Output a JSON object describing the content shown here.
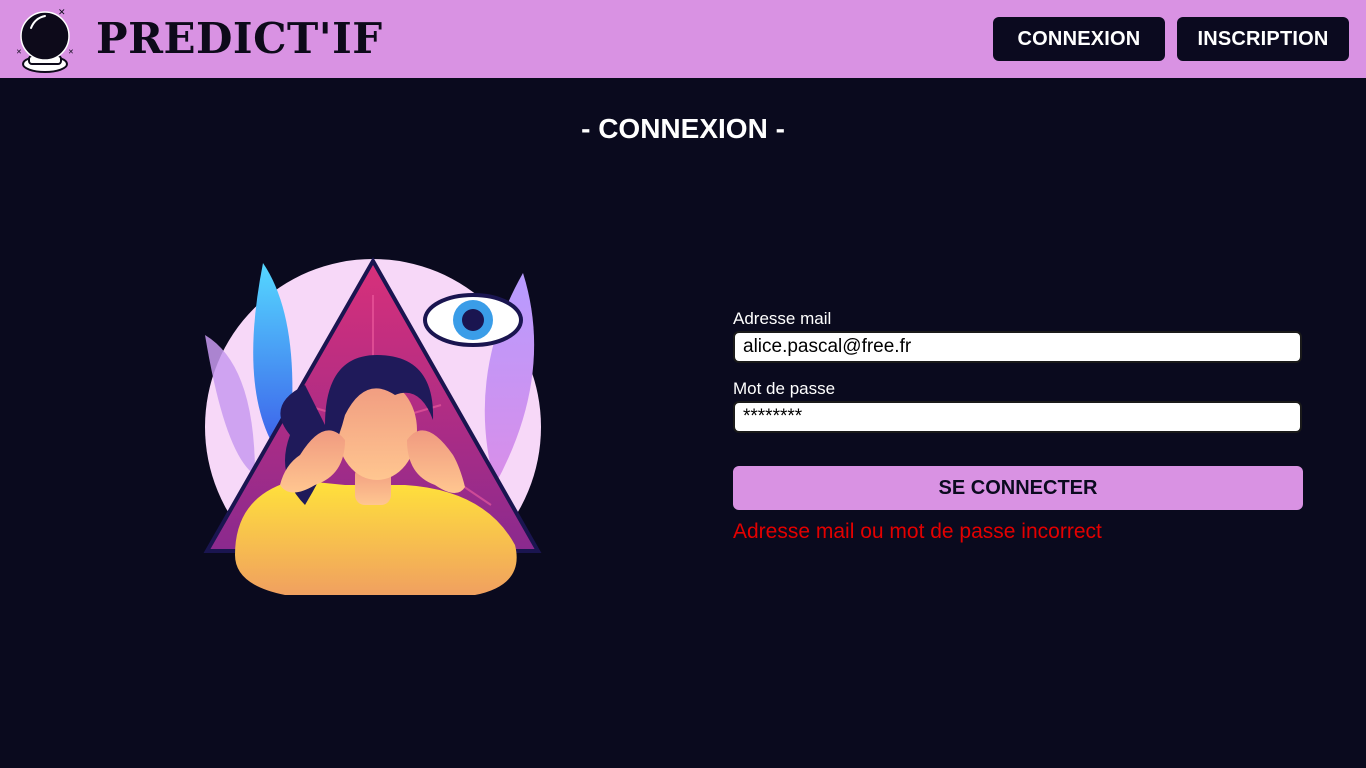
{
  "header": {
    "brand": "PREDICT'IF",
    "nav": {
      "login_label": "CONNEXION",
      "signup_label": "INSCRIPTION"
    }
  },
  "main": {
    "title": "- CONNEXION -",
    "form": {
      "email_label": "Adresse mail",
      "email_value": "alice.pascal@free.fr",
      "password_label": "Mot de passe",
      "password_value": "********",
      "submit_label": "SE CONNECTER",
      "error_message": "Adresse mail ou mot de passe incorrect"
    }
  },
  "icons": {
    "logo": "crystal-ball-icon",
    "illustration": "headache-pyramid-eye-illustration"
  },
  "colors": {
    "header_bg": "#d992e3",
    "page_bg": "#0a0a1e",
    "nav_button_bg": "#0b0a1f",
    "submit_bg": "#d992e3",
    "error_text": "#e30000"
  }
}
